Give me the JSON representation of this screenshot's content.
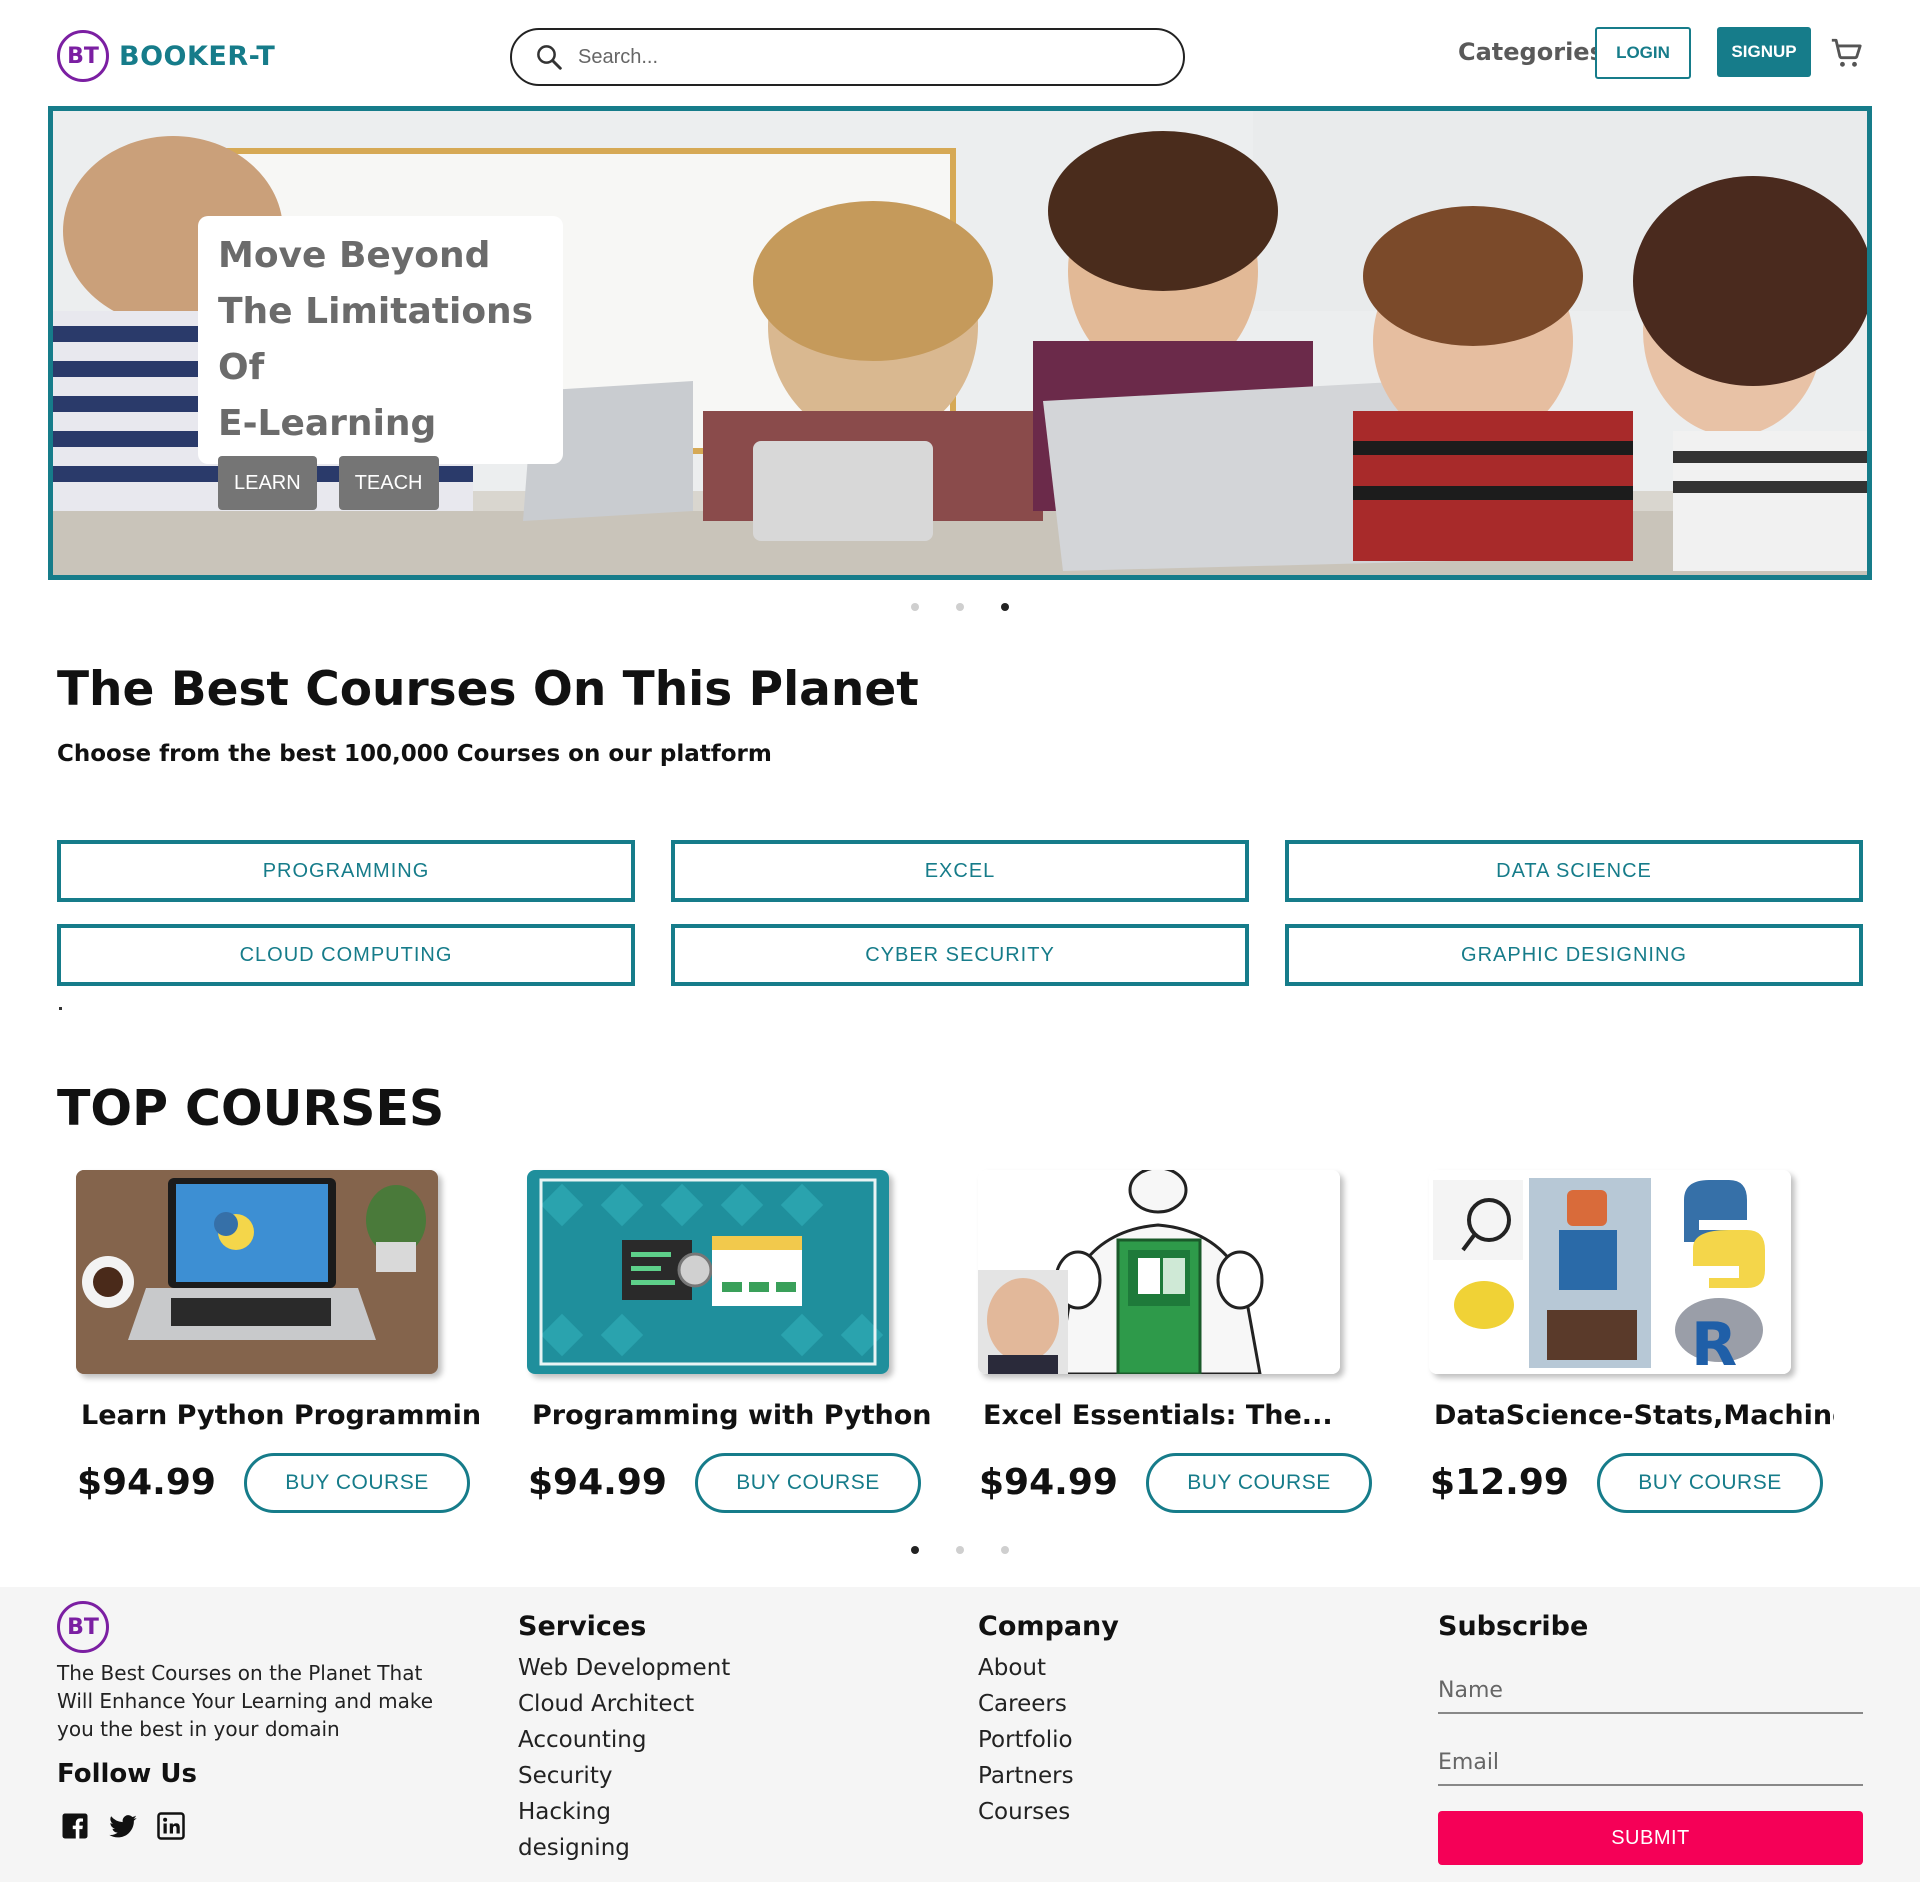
{
  "header": {
    "logo_badge": "BT",
    "logo_text": "BOOKER-T",
    "search_placeholder": "Search...",
    "categories_label": "Categories",
    "login_label": "LOGIN",
    "signup_label": "SIGNUP",
    "cart_icon": "shopping-cart-icon"
  },
  "hero": {
    "title_line1": "Move Beyond",
    "title_line2": "The Limitations Of",
    "title_line3": "E-Learning",
    "learn_label": "LEARN",
    "teach_label": "TEACH",
    "active_slide": 3,
    "slide_count": 3
  },
  "courses_intro": {
    "title": "The Best Courses On This Planet",
    "subtitle": "Choose from the best 100,000 Courses on our platform"
  },
  "categories": [
    "PROGRAMMING",
    "EXCEL",
    "DATA SCIENCE",
    "CLOUD COMPUTING",
    "CYBER SECURITY",
    "GRAPHIC DESIGNING"
  ],
  "top_courses": {
    "title": "TOP COURSES",
    "buy_label": "BUY COURSE",
    "active_page": 1,
    "page_count": 3,
    "items": [
      {
        "title": "Learn Python Programming...",
        "price": "$94.99"
      },
      {
        "title": "Programming with Python :...",
        "price": "$94.99"
      },
      {
        "title": "Excel Essentials: The...",
        "price": "$94.99"
      },
      {
        "title": "DataScience-Stats,Machine...",
        "price": "$12.99"
      }
    ]
  },
  "footer": {
    "logo_badge": "BT",
    "about": "The Best Courses on the Planet That Will Enhance Your Learning and make you the best in your domain",
    "follow_title": "Follow Us",
    "social_icons": [
      "facebook-icon",
      "twitter-icon",
      "linkedin-icon"
    ],
    "services": {
      "title": "Services",
      "links": [
        "Web Development",
        "Cloud Architect",
        "Accounting",
        "Security",
        "Hacking",
        "designing"
      ]
    },
    "company": {
      "title": "Company",
      "links": [
        "About",
        "Careers",
        "Portfolio",
        "Partners",
        "Courses"
      ]
    },
    "subscribe": {
      "title": "Subscribe",
      "name_placeholder": "Name",
      "email_placeholder": "Email",
      "submit_label": "SUBMIT"
    }
  },
  "colors": {
    "brand_teal": "#167c8a",
    "logo_purple": "#7b1fa2",
    "submit_pink": "#f50057"
  }
}
